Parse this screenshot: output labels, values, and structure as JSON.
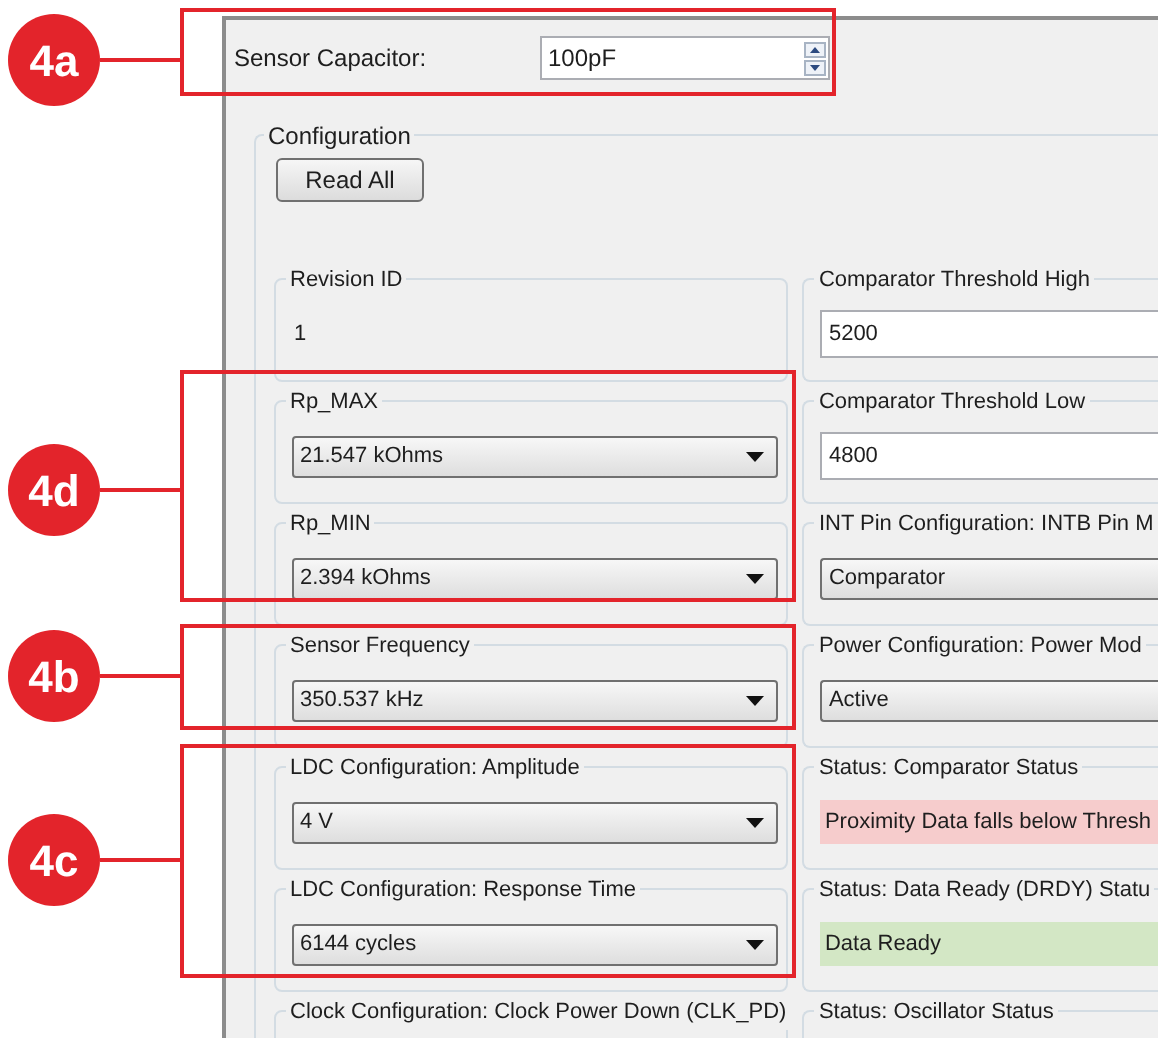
{
  "annotations": [
    {
      "label": "4a"
    },
    {
      "label": "4d"
    },
    {
      "label": "4b"
    },
    {
      "label": "4c"
    }
  ],
  "sensor_capacitor": {
    "label": "Sensor Capacitor:",
    "value": "100pF"
  },
  "configuration": {
    "title": "Configuration",
    "read_all_button": "Read All",
    "left_groups": [
      {
        "kind": "text",
        "title": "Revision ID",
        "value": "1"
      },
      {
        "kind": "dropdown",
        "title": "Rp_MAX",
        "value": "21.547 kOhms"
      },
      {
        "kind": "dropdown",
        "title": "Rp_MIN",
        "value": "2.394 kOhms"
      },
      {
        "kind": "dropdown",
        "title": "Sensor Frequency",
        "value": "350.537 kHz"
      },
      {
        "kind": "dropdown",
        "title": "LDC Configuration: Amplitude",
        "value": "4 V"
      },
      {
        "kind": "dropdown",
        "title": "LDC Configuration: Response Time",
        "value": "6144 cycles"
      },
      {
        "kind": "title",
        "title": "Clock Configuration: Clock Power Down (CLK_PD)"
      }
    ],
    "right_groups": [
      {
        "kind": "input",
        "title": "Comparator Threshold High",
        "value": "5200"
      },
      {
        "kind": "input",
        "title": "Comparator Threshold Low",
        "value": "4800"
      },
      {
        "kind": "dropdown",
        "title": "INT Pin Configuration: INTB Pin M",
        "value": "Comparator"
      },
      {
        "kind": "dropdown",
        "title": "Power Configuration: Power Mod",
        "value": "Active"
      },
      {
        "kind": "status",
        "title": "Status: Comparator Status",
        "value": "Proximity Data falls below Thresh",
        "color": "#f6cccc"
      },
      {
        "kind": "status",
        "title": "Status: Data Ready (DRDY) Statu",
        "value": "Data Ready",
        "color": "#d3e7c5"
      },
      {
        "kind": "title",
        "title": "Status: Oscillator Status"
      }
    ]
  }
}
